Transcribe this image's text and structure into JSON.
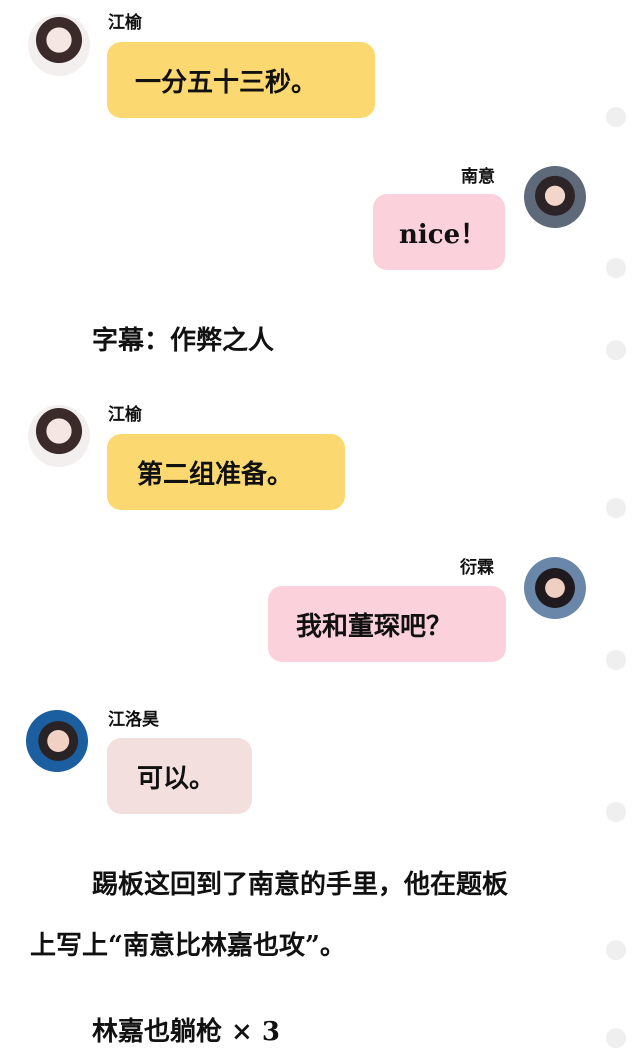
{
  "messages": [
    {
      "name": "江榆",
      "text": "一分五十三秒。",
      "side": "left",
      "bubble_color": "#fcd970"
    },
    {
      "name": "南意",
      "text": "nice！",
      "side": "right",
      "bubble_color": "#fbd1db"
    },
    {
      "name": "江榆",
      "text": "第二组准备。",
      "side": "left",
      "bubble_color": "#fcd970"
    },
    {
      "name": "衍霖",
      "text": "我和董琛吧？",
      "side": "right",
      "bubble_color": "#fbd1db"
    },
    {
      "name": "江洛昊",
      "text": "可以。",
      "side": "left",
      "bubble_color": "#f4dfdf"
    }
  ],
  "subtitle": "字幕：作弊之人",
  "narration": {
    "line1": "踢板这回到了南意的手里，他在题板",
    "line2": "上写上“南意比林嘉也攻”。",
    "tally": "林嘉也躺枪 × 3"
  },
  "colors": {
    "yellow_bubble": "#fcd970",
    "pink_bubble": "#fbd1db",
    "rose_bubble": "#f4dfdf",
    "scroll_dot": "#efefef"
  }
}
